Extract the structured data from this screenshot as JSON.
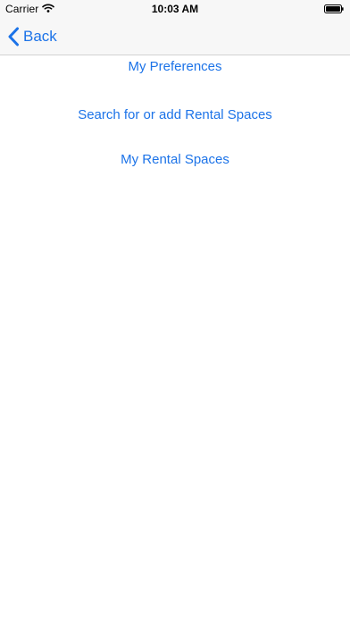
{
  "status_bar": {
    "carrier": "Carrier",
    "time": "10:03 AM",
    "wifi_icon": "wifi-icon",
    "battery_icon": "battery-icon"
  },
  "nav_bar": {
    "back_label": "Back",
    "back_icon": "chevron-left-icon"
  },
  "menu": {
    "items": [
      {
        "label": "My Preferences"
      },
      {
        "label": "Search for or add Rental Spaces"
      },
      {
        "label": "My Rental Spaces"
      }
    ]
  },
  "colors": {
    "accent": "#1c73e8",
    "bar_background": "#f7f7f7",
    "background": "#ffffff"
  }
}
